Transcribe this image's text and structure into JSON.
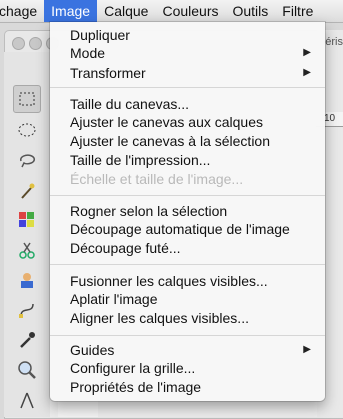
{
  "menubar": {
    "items": [
      "chage",
      "Image",
      "Calque",
      "Couleurs",
      "Outils",
      "Filtre"
    ]
  },
  "background": {
    "panel_peek": "éris",
    "ruler_tick": "10"
  },
  "image_menu": {
    "groups": [
      [
        {
          "label": "Dupliquer"
        },
        {
          "label": "Mode",
          "submenu": true
        },
        {
          "label": "Transformer",
          "submenu": true
        }
      ],
      [
        {
          "label": "Taille du canevas..."
        },
        {
          "label": "Ajuster le canevas aux calques"
        },
        {
          "label": "Ajuster le canevas à la sélection"
        },
        {
          "label": "Taille de l'impression..."
        },
        {
          "label": "Échelle et taille de l'image...",
          "disabled": true
        }
      ],
      [
        {
          "label": "Rogner selon la sélection"
        },
        {
          "label": "Découpage automatique de l'image"
        },
        {
          "label": "Découpage futé..."
        }
      ],
      [
        {
          "label": "Fusionner les calques visibles..."
        },
        {
          "label": "Aplatir l'image"
        },
        {
          "label": "Aligner les calques visibles..."
        }
      ],
      [
        {
          "label": "Guides",
          "submenu": true
        },
        {
          "label": "Configurer la grille..."
        },
        {
          "label": "Propriétés de l'image"
        }
      ]
    ]
  },
  "colors": {
    "accent": "#3a73e0",
    "disabled_text": "#b9b9b9"
  }
}
